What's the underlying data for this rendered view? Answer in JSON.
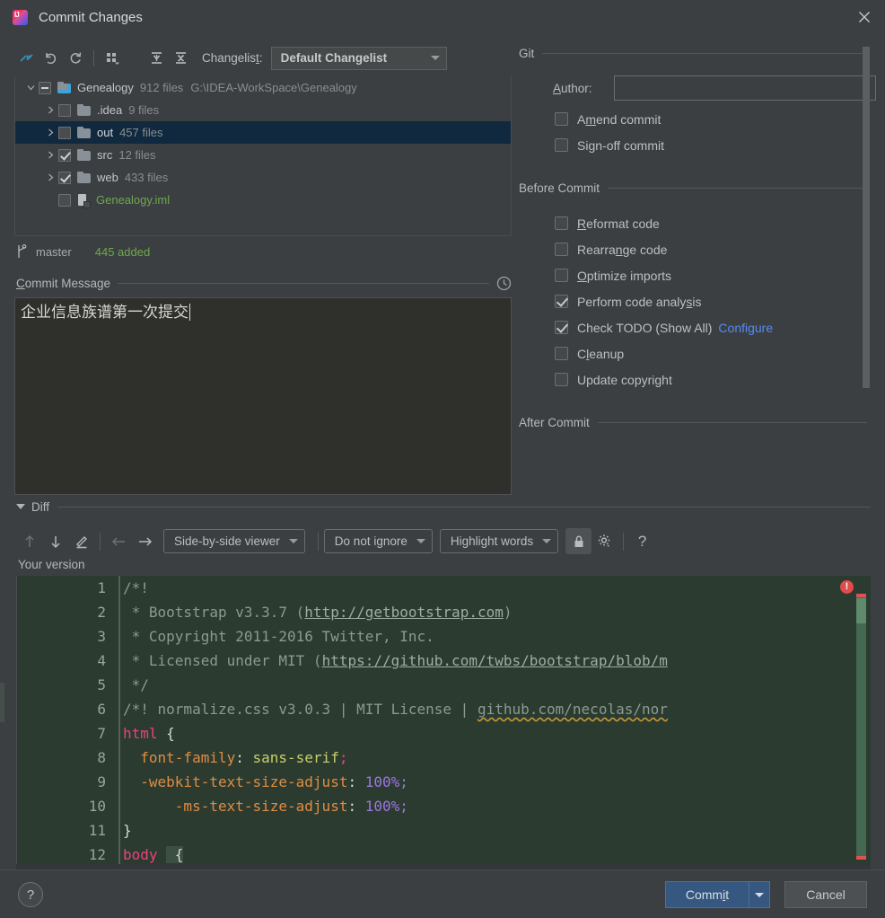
{
  "window": {
    "title": "Commit Changes",
    "app_icon": "intellij-idea-icon",
    "close_icon": "close-icon"
  },
  "toolbar": {
    "buttons": [
      {
        "name": "show-diff-icon",
        "tooltip": "Show Diff"
      },
      {
        "name": "revert-icon",
        "tooltip": "Revert"
      },
      {
        "name": "refresh-icon",
        "tooltip": "Refresh Changes"
      },
      {
        "name": "group-by-icon",
        "tooltip": "Group By"
      },
      {
        "name": "expand-all-icon",
        "tooltip": "Expand All"
      },
      {
        "name": "collapse-all-icon",
        "tooltip": "Collapse All"
      }
    ],
    "changelist_label": "Changelist:",
    "changelist_mnemonic": "t",
    "changelist_value": "Default Changelist"
  },
  "tree": {
    "nodes": [
      {
        "name": "Genealogy",
        "meta": "912 files",
        "path": "G:\\IDEA-WorkSpace\\Genealogy",
        "checkbox": "partial",
        "expanded": true,
        "indent": 0,
        "icon": "folder-modified-icon",
        "selected": false,
        "green": false
      },
      {
        "name": ".idea",
        "meta": "9 files",
        "path": "",
        "checkbox": "unchecked",
        "expanded": false,
        "indent": 1,
        "icon": "folder-icon",
        "selected": false,
        "green": false
      },
      {
        "name": "out",
        "meta": "457 files",
        "path": "",
        "checkbox": "unchecked",
        "expanded": false,
        "indent": 1,
        "icon": "folder-icon",
        "selected": true,
        "green": false
      },
      {
        "name": "src",
        "meta": "12 files",
        "path": "",
        "checkbox": "checked",
        "expanded": false,
        "indent": 1,
        "icon": "folder-icon",
        "selected": false,
        "green": false
      },
      {
        "name": "web",
        "meta": "433 files",
        "path": "",
        "checkbox": "checked",
        "expanded": false,
        "indent": 1,
        "icon": "folder-icon",
        "selected": false,
        "green": false
      },
      {
        "name": "Genealogy.iml",
        "meta": "",
        "path": "",
        "checkbox": "unchecked",
        "expanded": null,
        "indent": 1,
        "icon": "iml-file-icon",
        "selected": false,
        "green": true
      }
    ]
  },
  "branch_bar": {
    "icon": "git-branch-icon",
    "branch": "master",
    "added": "445 added",
    "added_color": "#6ea84f"
  },
  "commit_message": {
    "label": "Commit Message",
    "mnemonic": "C",
    "history_icon": "clock-history-icon",
    "value": "企业信息族谱第一次提交"
  },
  "options": {
    "git_section": {
      "title": "Git",
      "author_label": "Author:",
      "author_mnemonic": "A",
      "author_value": "",
      "checkboxes": [
        {
          "label": "Amend commit",
          "mnemonic": "m",
          "checked": false
        },
        {
          "label": "Sign-off commit",
          "mnemonic": "g",
          "checked": false
        }
      ]
    },
    "before_commit_section": {
      "title": "Before Commit",
      "checkboxes": [
        {
          "label": "Reformat code",
          "mnemonic": "R",
          "checked": false,
          "link": ""
        },
        {
          "label": "Rearrange code",
          "mnemonic": "n",
          "checked": false,
          "link": ""
        },
        {
          "label": "Optimize imports",
          "mnemonic": "O",
          "checked": false,
          "link": ""
        },
        {
          "label": "Perform code analysis",
          "mnemonic": "s",
          "checked": true,
          "link": ""
        },
        {
          "label": "Check TODO (Show All)",
          "mnemonic": "",
          "checked": true,
          "link": "Configure"
        },
        {
          "label": "Cleanup",
          "mnemonic": "l",
          "checked": false,
          "link": ""
        },
        {
          "label": "Update copyright",
          "mnemonic": "",
          "checked": false,
          "link": ""
        }
      ]
    },
    "after_commit_section": {
      "title": "After Commit"
    },
    "link_color": "#548af7"
  },
  "diff": {
    "section_title": "Diff",
    "collapse_icon": "triangle-down-icon",
    "toolbar": {
      "prev_diff_icon": "arrow-up-icon",
      "next_diff_icon": "arrow-down-icon",
      "edit_icon": "pencil-icon",
      "accept_left_icon": "arrow-left-icon",
      "accept_right_icon": "arrow-right-icon",
      "viewer_mode": "Side-by-side viewer",
      "ignore_mode": "Do not ignore",
      "highlight_mode": "Highlight words",
      "lock_icon": "lock-icon",
      "settings_icon": "gear-icon",
      "help_icon": "question-mark-icon"
    },
    "version_label": "Your version",
    "error_badge": "!",
    "code": {
      "line_numbers": [
        "1",
        "2",
        "3",
        "4",
        "5",
        "6",
        "7",
        "8",
        "9",
        "10",
        "11",
        "12"
      ],
      "lines": [
        "/*!",
        " * Bootstrap v3.3.7 (http://getbootstrap.com)",
        " * Copyright 2011-2016 Twitter, Inc.",
        " * Licensed under MIT (https://github.com/twbs/bootstrap/blob/m",
        " */",
        "/*! normalize.css v3.0.3 | MIT License | github.com/necolas/nor",
        "html {",
        "  font-family: sans-serif;",
        "  -webkit-text-size-adjust: 100%;",
        "      -ms-text-size-adjust: 100%;",
        "}",
        "body {"
      ]
    }
  },
  "bottom_bar": {
    "help_label": "?",
    "commit_label": "Commit",
    "commit_mnemonic": "i",
    "commit_dropdown_icon": "chevron-down-icon",
    "cancel_label": "Cancel",
    "commit_color": "#365880"
  }
}
